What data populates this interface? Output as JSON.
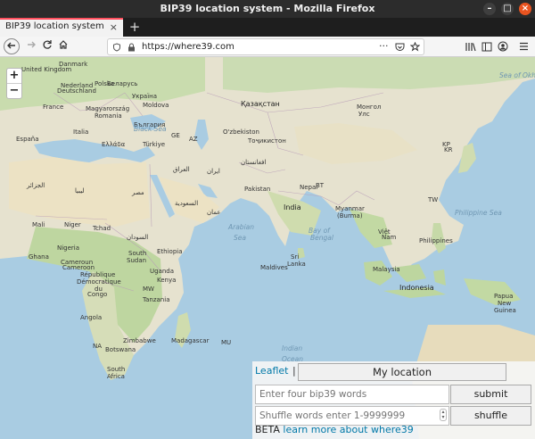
{
  "window": {
    "title": "BIP39 location system - Mozilla Firefox"
  },
  "tab": {
    "title": "BIP39 location system",
    "close": "×",
    "new": "+"
  },
  "nav": {
    "url": "https://where39.com",
    "more": "···"
  },
  "map": {
    "labels": [
      {
        "t": "Danmark",
        "c": "lbl"
      },
      {
        "t": "United Kingdom",
        "c": "lbl"
      },
      {
        "t": "Беларусь",
        "c": "lbl"
      },
      {
        "t": "Polska",
        "c": "lbl"
      },
      {
        "t": "Nederland",
        "c": "lbl"
      },
      {
        "t": "Deutschland",
        "c": "lbl"
      },
      {
        "t": "Україна",
        "c": "lbl"
      },
      {
        "t": "France",
        "c": "lbl"
      },
      {
        "t": "Magyarország",
        "c": "lbl"
      },
      {
        "t": "Moldova",
        "c": "lbl"
      },
      {
        "t": "Romania",
        "c": "lbl"
      },
      {
        "t": "Italia",
        "c": "lbl"
      },
      {
        "t": "България",
        "c": "lbl"
      },
      {
        "t": "España",
        "c": "lbl"
      },
      {
        "t": "Ελλάδα",
        "c": "lbl"
      },
      {
        "t": "Türkiye",
        "c": "lbl"
      },
      {
        "t": "Black Sea",
        "c": "lbl sea"
      },
      {
        "t": "Қазақстан",
        "c": "lbl big"
      },
      {
        "t": "Монгол",
        "c": "lbl"
      },
      {
        "t": "Улс",
        "c": "lbl"
      },
      {
        "t": "O'zbekiston",
        "c": "lbl"
      },
      {
        "t": "Тоҷикистон",
        "c": "lbl"
      },
      {
        "t": "Sea of Okhotsk",
        "c": "lbl sea"
      },
      {
        "t": "AZ",
        "c": "lbl"
      },
      {
        "t": "GE",
        "c": "lbl"
      },
      {
        "t": "الجزائر",
        "c": "lbl"
      },
      {
        "t": "ليبيا",
        "c": "lbl"
      },
      {
        "t": "مصر",
        "c": "lbl"
      },
      {
        "t": "العراق",
        "c": "lbl"
      },
      {
        "t": "ایران",
        "c": "lbl"
      },
      {
        "t": "Pakistan",
        "c": "lbl"
      },
      {
        "t": "افغانستان",
        "c": "lbl"
      },
      {
        "t": "Nepal",
        "c": "lbl"
      },
      {
        "t": "BT",
        "c": "lbl"
      },
      {
        "t": "India",
        "c": "lbl big"
      },
      {
        "t": "Myanmar",
        "c": "lbl"
      },
      {
        "t": "(Burma)",
        "c": "lbl"
      },
      {
        "t": "السعودية",
        "c": "lbl"
      },
      {
        "t": "عمان",
        "c": "lbl"
      },
      {
        "t": "Mali",
        "c": "lbl"
      },
      {
        "t": "Niger",
        "c": "lbl"
      },
      {
        "t": "Tchad",
        "c": "lbl"
      },
      {
        "t": "السودان",
        "c": "lbl"
      },
      {
        "t": "Arabian",
        "c": "lbl sea"
      },
      {
        "t": "Sea",
        "c": "lbl sea"
      },
      {
        "t": "Bay of",
        "c": "lbl sea"
      },
      {
        "t": "Bengal",
        "c": "lbl sea"
      },
      {
        "t": "Việt",
        "c": "lbl"
      },
      {
        "t": "Nam",
        "c": "lbl"
      },
      {
        "t": "Philippines",
        "c": "lbl"
      },
      {
        "t": "Philippine Sea",
        "c": "lbl sea"
      },
      {
        "t": "Nigeria",
        "c": "lbl"
      },
      {
        "t": "Ghana",
        "c": "lbl"
      },
      {
        "t": "Cameroun",
        "c": "lbl"
      },
      {
        "t": "Cameroon",
        "c": "lbl"
      },
      {
        "t": "South",
        "c": "lbl"
      },
      {
        "t": "Sudan",
        "c": "lbl"
      },
      {
        "t": "Ethiopia",
        "c": "lbl"
      },
      {
        "t": "Sri",
        "c": "lbl"
      },
      {
        "t": "Lanka",
        "c": "lbl"
      },
      {
        "t": "Maldives",
        "c": "lbl"
      },
      {
        "t": "Malaysia",
        "c": "lbl"
      },
      {
        "t": "Indonesia",
        "c": "lbl big"
      },
      {
        "t": "République",
        "c": "lbl"
      },
      {
        "t": "Démocratique",
        "c": "lbl"
      },
      {
        "t": "du",
        "c": "lbl"
      },
      {
        "t": "Congo",
        "c": "lbl"
      },
      {
        "t": "Uganda",
        "c": "lbl"
      },
      {
        "t": "Kenya",
        "c": "lbl"
      },
      {
        "t": "Tanzania",
        "c": "lbl"
      },
      {
        "t": "Papua",
        "c": "lbl"
      },
      {
        "t": "New",
        "c": "lbl"
      },
      {
        "t": "Guinea",
        "c": "lbl"
      },
      {
        "t": "Angola",
        "c": "lbl"
      },
      {
        "t": "Zimbabwe",
        "c": "lbl"
      },
      {
        "t": "Madagascar",
        "c": "lbl"
      },
      {
        "t": "Botswana",
        "c": "lbl"
      },
      {
        "t": "South",
        "c": "lbl"
      },
      {
        "t": "Africa",
        "c": "lbl"
      },
      {
        "t": "Indian",
        "c": "lbl sea"
      },
      {
        "t": "Ocean",
        "c": "lbl sea"
      },
      {
        "t": "KR",
        "c": "lbl"
      },
      {
        "t": "KP",
        "c": "lbl"
      },
      {
        "t": "TW",
        "c": "lbl"
      },
      {
        "t": "NA",
        "c": "lbl"
      },
      {
        "t": "MU",
        "c": "lbl"
      },
      {
        "t": "MW",
        "c": "lbl"
      }
    ]
  },
  "panel": {
    "leaflet": "Leaflet",
    "sep": "|",
    "my_location": "My location",
    "words_placeholder": "Enter four bip39 words",
    "submit": "submit",
    "shuffle_placeholder": "Shuffle words enter 1-9999999",
    "shuffle": "shuffle",
    "beta": "BETA",
    "learn": "learn more about where39"
  },
  "zoom": {
    "in": "+",
    "out": "−"
  }
}
